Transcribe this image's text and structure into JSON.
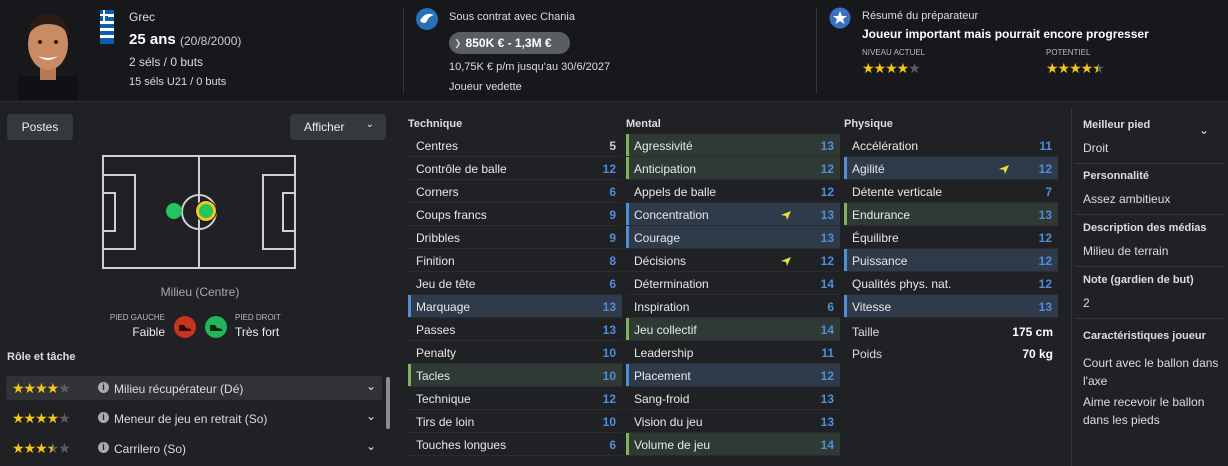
{
  "player": {
    "nationality": "Grec",
    "age": "25 ans",
    "birth": "(20/8/2000)",
    "caps": "2 séls / 0 buts",
    "u21": "15 séls U21 / 0 buts"
  },
  "contract": {
    "status": "Sous contrat avec Chania",
    "value": "850K € - 1,3M €",
    "wage": "10,75K € p/m jusqu'au 30/6/2027",
    "role": "Joueur vedette"
  },
  "scout": {
    "title": "Résumé du préparateur",
    "summary": "Joueur important mais pourrait encore progresser",
    "current_label": "NIVEAU ACTUEL",
    "potential_label": "POTENTIEL",
    "current_stars": 4,
    "potential_stars": 4.5
  },
  "left": {
    "positions_btn": "Postes",
    "show_btn": "Afficher",
    "position_label": "Milieu (Centre)",
    "left_foot_label": "PIED GAUCHE",
    "left_foot_value": "Faible",
    "right_foot_label": "PIED DROIT",
    "right_foot_value": "Très fort",
    "roles_title": "Rôle et tâche",
    "roles": [
      {
        "name": "Milieu récupérateur (Dé)",
        "stars": 4
      },
      {
        "name": "Meneur de jeu en retrait (So)",
        "stars": 4
      },
      {
        "name": "Carrilero (So)",
        "stars": 3.5
      }
    ]
  },
  "technique": {
    "title": "Technique",
    "attrs": [
      {
        "name": "Centres",
        "value": "5",
        "hl": ""
      },
      {
        "name": "Contrôle de balle",
        "value": "12",
        "hl": ""
      },
      {
        "name": "Corners",
        "value": "6",
        "hl": ""
      },
      {
        "name": "Coups francs",
        "value": "9",
        "hl": ""
      },
      {
        "name": "Dribbles",
        "value": "9",
        "hl": ""
      },
      {
        "name": "Finition",
        "value": "8",
        "hl": ""
      },
      {
        "name": "Jeu de tête",
        "value": "6",
        "hl": ""
      },
      {
        "name": "Marquage",
        "value": "13",
        "hl": "blue"
      },
      {
        "name": "Passes",
        "value": "13",
        "hl": ""
      },
      {
        "name": "Penalty",
        "value": "10",
        "hl": ""
      },
      {
        "name": "Tacles",
        "value": "10",
        "hl": "green"
      },
      {
        "name": "Technique",
        "value": "12",
        "hl": ""
      },
      {
        "name": "Tirs de loin",
        "value": "10",
        "hl": ""
      },
      {
        "name": "Touches longues",
        "value": "6",
        "hl": ""
      }
    ]
  },
  "mental": {
    "title": "Mental",
    "attrs": [
      {
        "name": "Agressivité",
        "value": "13",
        "hl": "green"
      },
      {
        "name": "Anticipation",
        "value": "12",
        "hl": "green"
      },
      {
        "name": "Appels de balle",
        "value": "12",
        "hl": ""
      },
      {
        "name": "Concentration",
        "value": "13",
        "hl": "blue",
        "arrow": true
      },
      {
        "name": "Courage",
        "value": "13",
        "hl": "blue"
      },
      {
        "name": "Décisions",
        "value": "12",
        "hl": "",
        "arrow": true
      },
      {
        "name": "Détermination",
        "value": "14",
        "hl": ""
      },
      {
        "name": "Inspiration",
        "value": "6",
        "hl": ""
      },
      {
        "name": "Jeu collectif",
        "value": "14",
        "hl": "green"
      },
      {
        "name": "Leadership",
        "value": "11",
        "hl": ""
      },
      {
        "name": "Placement",
        "value": "12",
        "hl": "blue"
      },
      {
        "name": "Sang-froid",
        "value": "13",
        "hl": ""
      },
      {
        "name": "Vision du jeu",
        "value": "13",
        "hl": ""
      },
      {
        "name": "Volume de jeu",
        "value": "14",
        "hl": "green"
      }
    ]
  },
  "physique": {
    "title": "Physique",
    "attrs": [
      {
        "name": "Accélération",
        "value": "11",
        "hl": ""
      },
      {
        "name": "Agilité",
        "value": "12",
        "hl": "blue",
        "arrow": true
      },
      {
        "name": "Détente verticale",
        "value": "7",
        "hl": ""
      },
      {
        "name": "Endurance",
        "value": "13",
        "hl": "green"
      },
      {
        "name": "Équilibre",
        "value": "12",
        "hl": ""
      },
      {
        "name": "Puissance",
        "value": "12",
        "hl": "blue"
      },
      {
        "name": "Qualités phys. nat.",
        "value": "12",
        "hl": ""
      },
      {
        "name": "Vitesse",
        "value": "13",
        "hl": "blue"
      }
    ],
    "height_label": "Taille",
    "height": "175 cm",
    "weight_label": "Poids",
    "weight": "70 kg"
  },
  "info": {
    "foot_label": "Meilleur pied",
    "foot": "Droit",
    "personality_label": "Personnalité",
    "personality": "Assez ambitieux",
    "media_label": "Description des médias",
    "media": "Milieu de terrain",
    "gk_label": "Note (gardien de but)",
    "gk": "2",
    "traits_label": "Caractéristiques joueur",
    "traits": [
      "Court avec le ballon dans l'axe",
      "Aime recevoir le ballon dans les pieds"
    ]
  },
  "colors": {
    "accent_blue": "#4f8fd8",
    "accent_green": "#7fb35a",
    "star": "#f5c518",
    "pitch_dot": "#22c55e"
  }
}
